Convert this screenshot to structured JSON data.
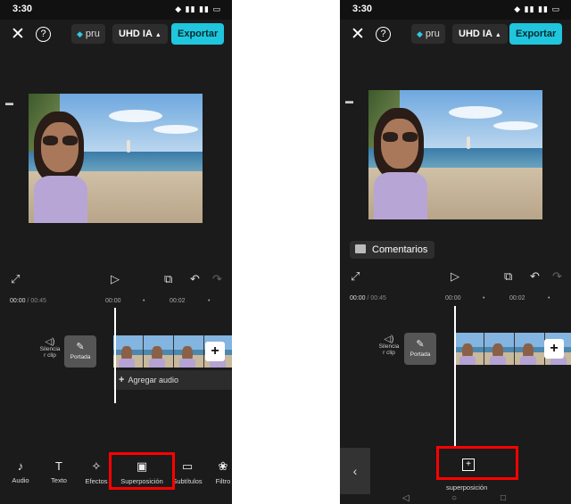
{
  "left": {
    "status": {
      "time": "3:30",
      "icons": "◆ ▮▮ ▮▮ ▭"
    },
    "topbar": {
      "close": "✕",
      "help": "?",
      "pro_gem": "◆",
      "pro_label": "pru",
      "resolution": "UHD IA",
      "resolution_caret": "▲",
      "export_label": "Exportar"
    },
    "canvas_icon": "▬",
    "controls": {
      "fullscreen": "⤢",
      "play": "▷",
      "keyframe": "⧉",
      "undo": "↶",
      "redo": "↷"
    },
    "timeline": {
      "current_time": "00:00",
      "duration": "/ 00:45",
      "marks": [
        "00:00",
        "•",
        "00:02",
        "•"
      ],
      "mute_icon": "◁)",
      "mute_label": "Silencia r clip",
      "cover_icon": "✎",
      "cover_label": "Portada",
      "add_clip": "+",
      "add_audio_plus": "+",
      "add_audio_label": "Agregar audio"
    },
    "toolbar": [
      {
        "icon": "♪",
        "label": "Audio"
      },
      {
        "icon": "T",
        "label": "Texto"
      },
      {
        "icon": "✧",
        "label": "Efectos"
      },
      {
        "icon": "▣",
        "label": "Superposición"
      },
      {
        "icon": "▭",
        "label": "Subtítulos"
      },
      {
        "icon": "❀",
        "label": "Filtro"
      }
    ]
  },
  "right": {
    "status": {
      "time": "3:30",
      "icons": "◆ ▮▮ ▮▮ ▭"
    },
    "topbar": {
      "close": "✕",
      "help": "?",
      "pro_gem": "◆",
      "pro_label": "pru",
      "resolution": "UHD IA",
      "resolution_caret": "▲",
      "export_label": "Exportar"
    },
    "canvas_icon": "▬",
    "comments_label": "Comentarios",
    "controls": {
      "fullscreen": "⤢",
      "play": "▷",
      "keyframe": "⧉",
      "undo": "↶",
      "redo": "↷"
    },
    "timeline": {
      "current_time": "00:00",
      "duration": "/ 00:45",
      "marks": [
        "00:00",
        "•",
        "00:02",
        "•"
      ],
      "mute_icon": "◁)",
      "mute_label": "Silencia r clip",
      "cover_icon": "✎",
      "cover_label": "Portada",
      "add_clip": "+"
    },
    "back_icon": "‹",
    "overlay_add_icon": "+",
    "overlay_label": "superposición",
    "navbar": {
      "back": "◁",
      "home": "○",
      "recents": "□"
    }
  },
  "colors": {
    "accent": "#1fc6dd",
    "highlight": "#ff0000",
    "background": "#1b1b1b"
  }
}
